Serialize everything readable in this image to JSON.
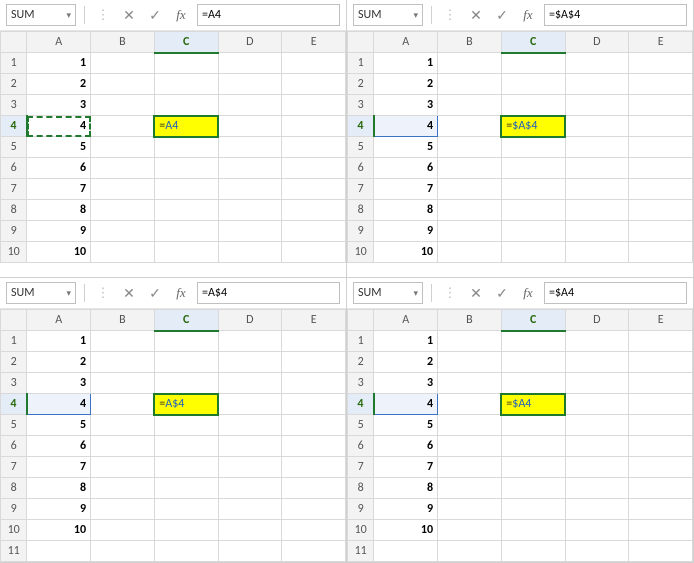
{
  "panels": [
    {
      "namebox": "SUM",
      "formula": "=A4",
      "c4_text": "=A4",
      "c4_blue": "A4",
      "ref_style": "dash"
    },
    {
      "namebox": "SUM",
      "formula": "=$A$4",
      "c4_text": "=$A$4",
      "c4_blue": "$A$4",
      "ref_style": "solid"
    },
    {
      "namebox": "SUM",
      "formula": "=A$4",
      "c4_text": "=A$4",
      "c4_blue": "A$4",
      "ref_style": "solid"
    },
    {
      "namebox": "SUM",
      "formula": "=$A4",
      "c4_text": "=$A4",
      "c4_blue": "$A4",
      "ref_style": "solid"
    }
  ],
  "columns": [
    "A",
    "B",
    "C",
    "D",
    "E"
  ],
  "rows": [
    1,
    2,
    3,
    4,
    5,
    6,
    7,
    8,
    9,
    10,
    11
  ],
  "colA": {
    "1": "1",
    "2": "2",
    "3": "3",
    "4": "4",
    "5": "5",
    "6": "6",
    "7": "7",
    "8": "8",
    "9": "9",
    "10": "10"
  },
  "active_col": "C",
  "active_row": 4,
  "icons": {
    "cancel": "✕",
    "enter": "✓",
    "fx": "fx",
    "chev": "▾"
  }
}
